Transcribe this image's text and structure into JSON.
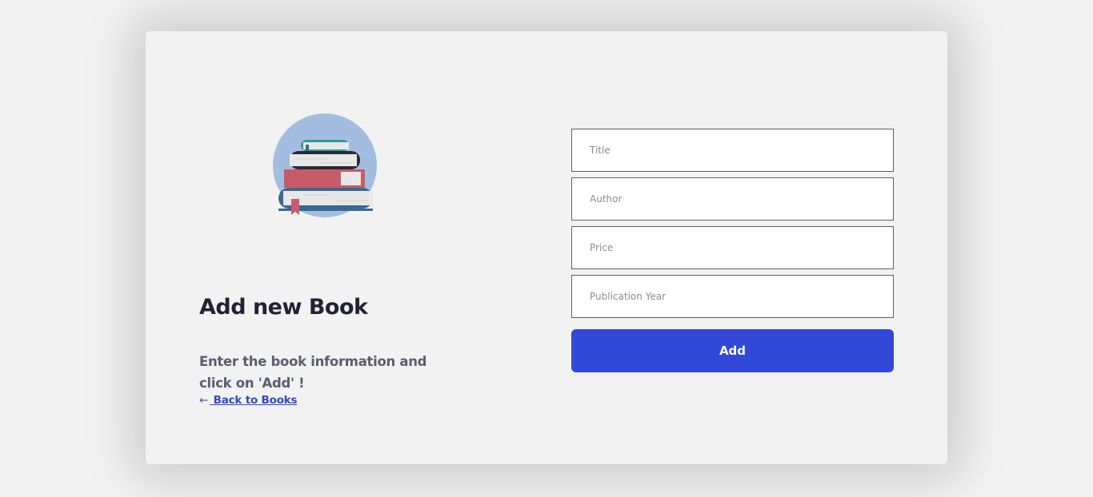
{
  "header": {
    "title": "Add new Book",
    "subtitle": "Enter the book information and click on 'Add' !",
    "back_link": "Back to Books",
    "back_arrow": "←"
  },
  "illustration": {
    "icon": "books-stack-icon",
    "colors": {
      "circle": "#a3bde0",
      "red_book": "#c75b68",
      "blue_book": "#3b6892",
      "dark_book": "#272b35",
      "teal_book": "#2a9d8f",
      "pages": "#e8e8e8"
    }
  },
  "form": {
    "fields": [
      {
        "placeholder": "Title",
        "value": ""
      },
      {
        "placeholder": "Author",
        "value": ""
      },
      {
        "placeholder": "Price",
        "value": ""
      },
      {
        "placeholder": "Publication Year",
        "value": ""
      }
    ],
    "submit_label": "Add"
  },
  "colors": {
    "accent": "#3248d9",
    "link": "#3548c7",
    "background": "#f2f2f2"
  }
}
